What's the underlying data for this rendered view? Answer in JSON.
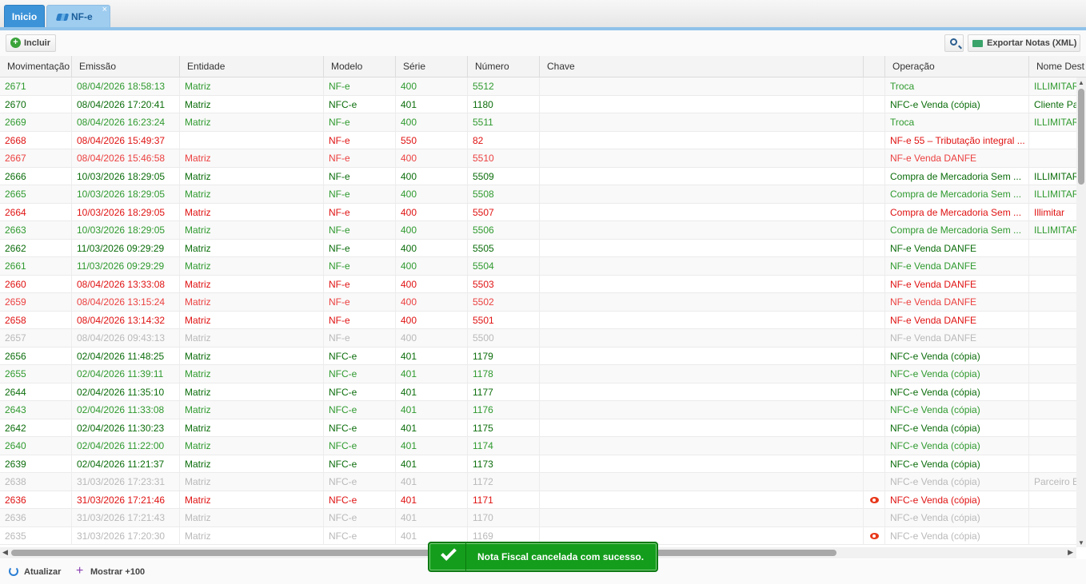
{
  "tabs": [
    {
      "label": "Inicio",
      "active": true
    },
    {
      "label": "NF-e",
      "active": false
    }
  ],
  "toolbar": {
    "incluir_label": "Incluir",
    "export_label": "Exportar Notas (XML)"
  },
  "columns": [
    "Movimentação",
    "Emissão",
    "Entidade",
    "Modelo",
    "Série",
    "Número",
    "Chave",
    "",
    "Operação",
    "Nome Dest"
  ],
  "rows": [
    {
      "c": "green",
      "mov": "2671",
      "emi": "08/04/2026 18:58:13",
      "ent": "Matriz",
      "mod": "NF-e",
      "ser": "400",
      "num": "5512",
      "eye": false,
      "op": "Troca",
      "dest": "ILLIMITAR"
    },
    {
      "c": "dgreen",
      "mov": "2670",
      "emi": "08/04/2026 17:20:41",
      "ent": "Matriz",
      "mod": "NFC-e",
      "ser": "401",
      "num": "1180",
      "eye": false,
      "op": "NFC-e Venda (cópia)",
      "dest": "Cliente Pa"
    },
    {
      "c": "green",
      "mov": "2669",
      "emi": "08/04/2026 16:23:24",
      "ent": "Matriz",
      "mod": "NF-e",
      "ser": "400",
      "num": "5511",
      "eye": false,
      "op": "Troca",
      "dest": "ILLIMITAR"
    },
    {
      "c": "red",
      "mov": "2668",
      "emi": "08/04/2026 15:49:37",
      "ent": "",
      "mod": "NF-e",
      "ser": "550",
      "num": "82",
      "eye": false,
      "op": "NF-e 55 – Tributação integral ...",
      "dest": ""
    },
    {
      "c": "lred",
      "mov": "2667",
      "emi": "08/04/2026 15:46:58",
      "ent": "Matriz",
      "mod": "NF-e",
      "ser": "400",
      "num": "5510",
      "eye": false,
      "op": "NF-e Venda DANFE",
      "dest": ""
    },
    {
      "c": "dgreen",
      "mov": "2666",
      "emi": "10/03/2026 18:29:05",
      "ent": "Matriz",
      "mod": "NF-e",
      "ser": "400",
      "num": "5509",
      "eye": false,
      "op": "Compra de Mercadoria Sem ...",
      "dest": "ILLIMITAR"
    },
    {
      "c": "green",
      "mov": "2665",
      "emi": "10/03/2026 18:29:05",
      "ent": "Matriz",
      "mod": "NF-e",
      "ser": "400",
      "num": "5508",
      "eye": false,
      "op": "Compra de Mercadoria Sem ...",
      "dest": "ILLIMITAR"
    },
    {
      "c": "red",
      "mov": "2664",
      "emi": "10/03/2026 18:29:05",
      "ent": "Matriz",
      "mod": "NF-e",
      "ser": "400",
      "num": "5507",
      "eye": false,
      "op": "Compra de Mercadoria Sem ...",
      "dest": "Illimitar"
    },
    {
      "c": "green",
      "mov": "2663",
      "emi": "10/03/2026 18:29:05",
      "ent": "Matriz",
      "mod": "NF-e",
      "ser": "400",
      "num": "5506",
      "eye": false,
      "op": "Compra de Mercadoria Sem ...",
      "dest": "ILLIMITAR"
    },
    {
      "c": "dgreen",
      "mov": "2662",
      "emi": "11/03/2026 09:29:29",
      "ent": "Matriz",
      "mod": "NF-e",
      "ser": "400",
      "num": "5505",
      "eye": false,
      "op": "NF-e Venda DANFE",
      "dest": ""
    },
    {
      "c": "green",
      "mov": "2661",
      "emi": "11/03/2026 09:29:29",
      "ent": "Matriz",
      "mod": "NF-e",
      "ser": "400",
      "num": "5504",
      "eye": false,
      "op": "NF-e Venda DANFE",
      "dest": ""
    },
    {
      "c": "red",
      "mov": "2660",
      "emi": "08/04/2026 13:33:08",
      "ent": "Matriz",
      "mod": "NF-e",
      "ser": "400",
      "num": "5503",
      "eye": false,
      "op": "NF-e Venda DANFE",
      "dest": ""
    },
    {
      "c": "lred",
      "mov": "2659",
      "emi": "08/04/2026 13:15:24",
      "ent": "Matriz",
      "mod": "NF-e",
      "ser": "400",
      "num": "5502",
      "eye": false,
      "op": "NF-e Venda DANFE",
      "dest": ""
    },
    {
      "c": "red",
      "mov": "2658",
      "emi": "08/04/2026 13:14:32",
      "ent": "Matriz",
      "mod": "NF-e",
      "ser": "400",
      "num": "5501",
      "eye": false,
      "op": "NF-e Venda DANFE",
      "dest": ""
    },
    {
      "c": "gray",
      "mov": "2657",
      "emi": "08/04/2026 09:43:13",
      "ent": "Matriz",
      "mod": "NF-e",
      "ser": "400",
      "num": "5500",
      "eye": false,
      "op": "NF-e Venda DANFE",
      "dest": ""
    },
    {
      "c": "dgreen",
      "mov": "2656",
      "emi": "02/04/2026 11:48:25",
      "ent": "Matriz",
      "mod": "NFC-e",
      "ser": "401",
      "num": "1179",
      "eye": false,
      "op": "NFC-e Venda (cópia)",
      "dest": ""
    },
    {
      "c": "green",
      "mov": "2655",
      "emi": "02/04/2026 11:39:11",
      "ent": "Matriz",
      "mod": "NFC-e",
      "ser": "401",
      "num": "1178",
      "eye": false,
      "op": "NFC-e Venda (cópia)",
      "dest": ""
    },
    {
      "c": "dgreen",
      "mov": "2644",
      "emi": "02/04/2026 11:35:10",
      "ent": "Matriz",
      "mod": "NFC-e",
      "ser": "401",
      "num": "1177",
      "eye": false,
      "op": "NFC-e Venda (cópia)",
      "dest": ""
    },
    {
      "c": "green",
      "mov": "2643",
      "emi": "02/04/2026 11:33:08",
      "ent": "Matriz",
      "mod": "NFC-e",
      "ser": "401",
      "num": "1176",
      "eye": false,
      "op": "NFC-e Venda (cópia)",
      "dest": ""
    },
    {
      "c": "dgreen",
      "mov": "2642",
      "emi": "02/04/2026 11:30:23",
      "ent": "Matriz",
      "mod": "NFC-e",
      "ser": "401",
      "num": "1175",
      "eye": false,
      "op": "NFC-e Venda (cópia)",
      "dest": ""
    },
    {
      "c": "green",
      "mov": "2640",
      "emi": "02/04/2026 11:22:00",
      "ent": "Matriz",
      "mod": "NFC-e",
      "ser": "401",
      "num": "1174",
      "eye": false,
      "op": "NFC-e Venda (cópia)",
      "dest": ""
    },
    {
      "c": "dgreen",
      "mov": "2639",
      "emi": "02/04/2026 11:21:37",
      "ent": "Matriz",
      "mod": "NFC-e",
      "ser": "401",
      "num": "1173",
      "eye": false,
      "op": "NFC-e Venda (cópia)",
      "dest": ""
    },
    {
      "c": "gray",
      "mov": "2638",
      "emi": "31/03/2026 17:23:31",
      "ent": "Matriz",
      "mod": "NFC-e",
      "ser": "401",
      "num": "1172",
      "eye": false,
      "op": "NFC-e Venda (cópia)",
      "dest": "Parceiro E"
    },
    {
      "c": "red",
      "mov": "2636",
      "emi": "31/03/2026 17:21:46",
      "ent": "Matriz",
      "mod": "NFC-e",
      "ser": "401",
      "num": "1171",
      "eye": true,
      "op": "NFC-e Venda (cópia)",
      "dest": ""
    },
    {
      "c": "gray",
      "mov": "2636",
      "emi": "31/03/2026 17:21:43",
      "ent": "Matriz",
      "mod": "NFC-e",
      "ser": "401",
      "num": "1170",
      "eye": false,
      "op": "NFC-e Venda (cópia)",
      "dest": ""
    },
    {
      "c": "gray",
      "mov": "2635",
      "emi": "31/03/2026 17:20:30",
      "ent": "Matriz",
      "mod": "NFC-e",
      "ser": "401",
      "num": "1169",
      "eye": true,
      "op": "NFC-e Venda (cópia)",
      "dest": ""
    }
  ],
  "footer": {
    "refresh_label": "Atualizar",
    "more_label": "Mostrar +100"
  },
  "toast": {
    "message": "Nota Fiscal cancelada com sucesso."
  },
  "colors": {
    "accent": "#3d93d8",
    "success": "#149d1c",
    "row_green": "#2f9a2f",
    "row_dark_green": "#0b6d0b",
    "row_red": "#e01212",
    "row_gray": "#b9b9b9"
  }
}
